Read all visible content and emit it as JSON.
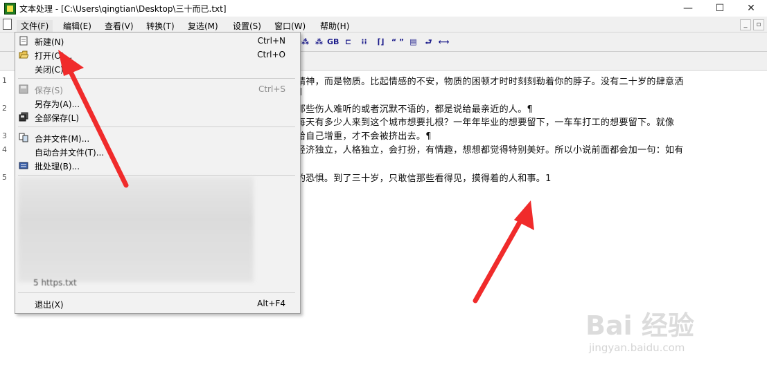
{
  "window": {
    "title": "文本处理 - [C:\\Users\\qingtian\\Desktop\\三十而已.txt]",
    "minimize": "—",
    "maximize": "☐",
    "close": "✕"
  },
  "menubar": {
    "items": [
      "文件(F)",
      "编辑(E)",
      "查看(V)",
      "转换(T)",
      "复选(M)",
      "设置(S)",
      "窗口(W)",
      "帮助(H)"
    ],
    "mdi_min": "_",
    "mdi_restore": "▫"
  },
  "toolbar": {
    "icons": [
      "book-a-icon",
      "book-b-icon",
      "gb-convert-icon",
      "line-icon",
      "dots-icon",
      "bracket-icon",
      "quote-icon",
      "page-icon",
      "return-icon",
      "width-icon"
    ],
    "glyphs": [
      "⁂",
      "⁂",
      "GB",
      "⊏",
      "⁞⁞",
      "⌈⌋",
      "“ ”",
      "▤",
      "⮐",
      "⟷"
    ]
  },
  "file_menu": {
    "items": [
      {
        "label": "新建(N)",
        "shortcut": "Ctrl+N",
        "icon": "new-file-icon",
        "enabled": true
      },
      {
        "label": "打开(O)...",
        "shortcut": "Ctrl+O",
        "icon": "open-folder-icon",
        "enabled": true
      },
      {
        "label": "关闭(C)",
        "shortcut": "",
        "icon": "",
        "enabled": true
      },
      {
        "label": "保存(S)",
        "shortcut": "Ctrl+S",
        "icon": "save-icon",
        "enabled": false
      },
      {
        "label": "另存为(A)...",
        "shortcut": "",
        "icon": "",
        "enabled": true
      },
      {
        "label": "全部保存(L)",
        "shortcut": "",
        "icon": "save-all-icon",
        "enabled": true
      },
      {
        "label": "合并文件(M)...",
        "shortcut": "",
        "icon": "merge-icon",
        "enabled": true
      },
      {
        "label": "自动合并文件(T)...",
        "shortcut": "",
        "icon": "",
        "enabled": true
      },
      {
        "label": "批处理(B)...",
        "shortcut": "",
        "icon": "batch-icon",
        "enabled": true
      },
      {
        "label": "退出(X)",
        "shortcut": "Alt+F4",
        "icon": "",
        "enabled": true
      }
    ],
    "recent_partial": "5 https.txt"
  },
  "editor": {
    "lines": [
      "精神，而是物质。比起情感的不安，物质的困顿才时时刻刻勒着你的脖子。没有二十岁的肆意洒",
      "¶",
      "那些伤人难听的或者沉默不语的，都是说给最亲近的人。¶",
      " 每天有多少人来到这个城市想要扎根？一年年毕业的想要留下，一车车打工的想要留下。就像",
      "给自己增重，才不会被挤出去。¶",
      "经济独立，人格独立，会打扮，有情趣，想想都觉得特别美好。所以小说前面都会加一句：如有",
      "",
      "的恐惧。到了三十岁，只敢信那些看得见，摸得着的人和事。1"
    ],
    "gutter": [
      "1",
      "2",
      "3",
      "4",
      "5"
    ]
  },
  "watermark": {
    "brand": "Bai 经验",
    "url": "jingyan.baidu.com"
  },
  "colors": {
    "arrow": "#f02b2b",
    "menu_bg": "#f2f2f2"
  }
}
